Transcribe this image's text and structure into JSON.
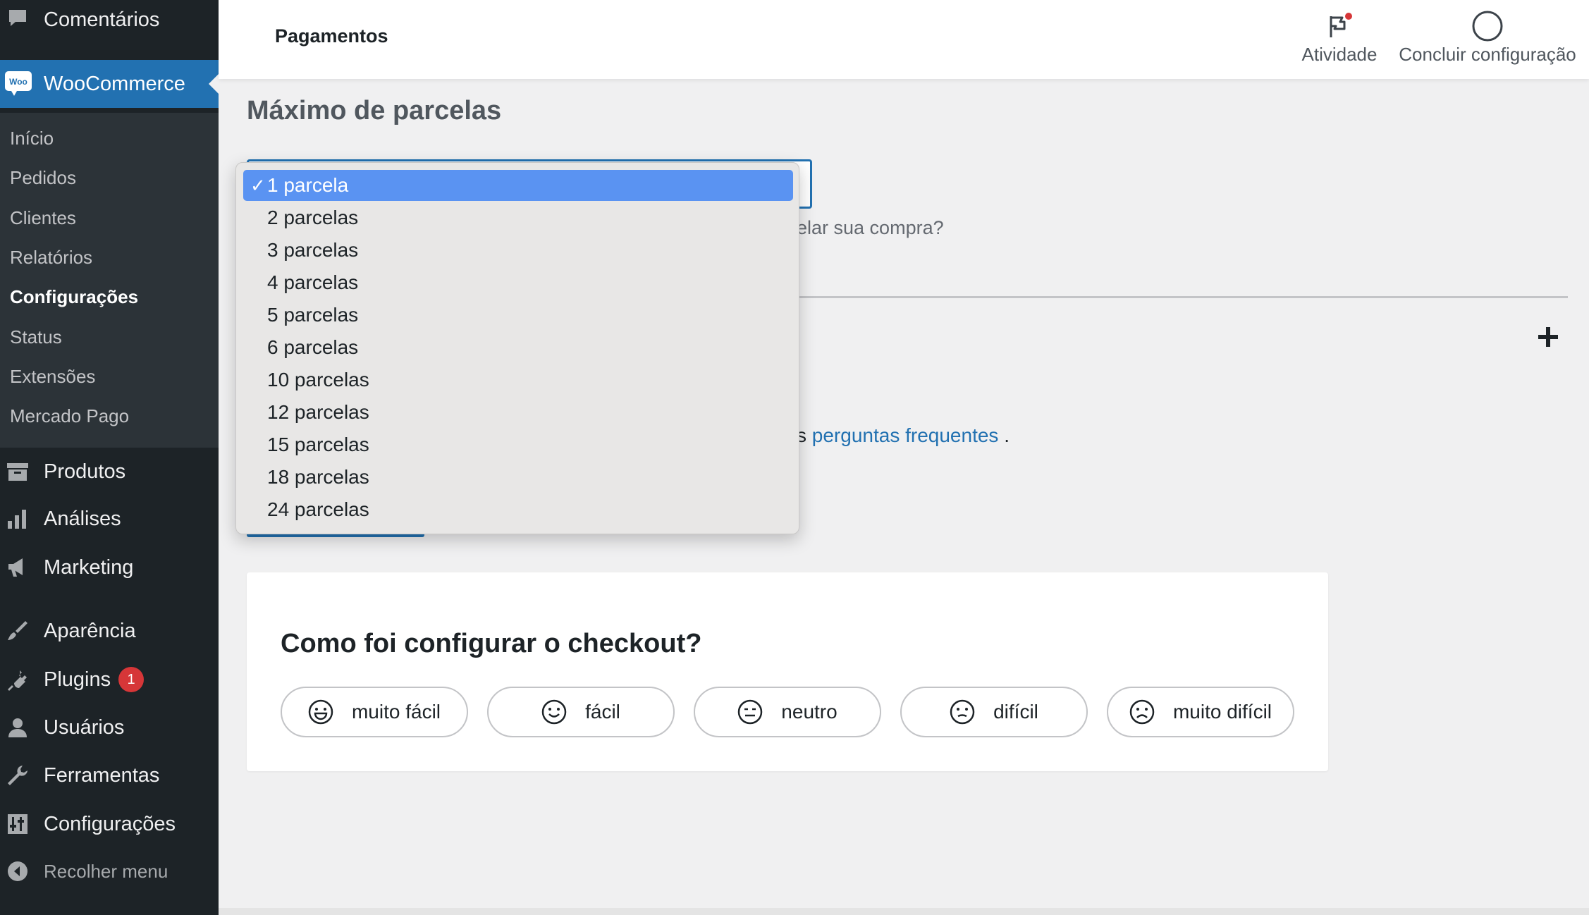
{
  "sidebar": {
    "items_top": [
      {
        "label": "Comentários",
        "icon": "comment-icon"
      }
    ],
    "woocommerce": {
      "label": "WooCommerce",
      "icon": "woo-logo-icon",
      "icon_text": "Woo"
    },
    "submenu": [
      {
        "label": "Início"
      },
      {
        "label": "Pedidos"
      },
      {
        "label": "Clientes"
      },
      {
        "label": "Relatórios"
      },
      {
        "label": "Configurações",
        "current": true
      },
      {
        "label": "Status"
      },
      {
        "label": "Extensões"
      },
      {
        "label": "Mercado Pago"
      }
    ],
    "items": [
      {
        "label": "Produtos",
        "icon": "archive-icon"
      },
      {
        "label": "Análises",
        "icon": "bar-chart-icon"
      },
      {
        "label": "Marketing",
        "icon": "megaphone-icon"
      },
      {
        "label": "Aparência",
        "icon": "brush-icon"
      },
      {
        "label": "Plugins",
        "icon": "plug-icon",
        "badge": "1"
      },
      {
        "label": "Usuários",
        "icon": "user-icon"
      },
      {
        "label": "Ferramentas",
        "icon": "wrench-icon"
      },
      {
        "label": "Configurações",
        "icon": "sliders-icon"
      }
    ],
    "collapse": {
      "label": "Recolher menu",
      "icon": "collapse-icon"
    }
  },
  "header": {
    "title": "Pagamentos",
    "activity": {
      "label": "Atividade",
      "icon": "flag-icon"
    },
    "setup": {
      "label": "Concluir configuração",
      "icon": "circle-progress-icon"
    }
  },
  "main": {
    "section_title": "Máximo de parcelas",
    "help_text_visible": "elar sua compra?",
    "faq_prefix": "s",
    "faq_link": "perguntas frequentes",
    "faq_suffix": "."
  },
  "dropdown": {
    "selected_check": "✓",
    "options": [
      "1 parcela",
      "2 parcelas",
      "3 parcelas",
      "4 parcelas",
      "5 parcelas",
      "6 parcelas",
      "10 parcelas",
      "12 parcelas",
      "15 parcelas",
      "18 parcelas",
      "24 parcelas"
    ],
    "selected_index": 0
  },
  "feedback": {
    "title": "Como foi configurar o checkout?",
    "options": [
      {
        "label": "muito fácil",
        "icon": "very-happy-face-icon"
      },
      {
        "label": "fácil",
        "icon": "happy-face-icon"
      },
      {
        "label": "neutro",
        "icon": "neutral-face-icon"
      },
      {
        "label": "difícil",
        "icon": "slightly-sad-face-icon"
      },
      {
        "label": "muito difícil",
        "icon": "sad-face-icon"
      }
    ]
  },
  "colors": {
    "sidebar_bg": "#1d2327",
    "submenu_bg": "#2c3338",
    "accent": "#2271b1",
    "badge": "#d63638",
    "dropdown_highlight": "#5a93f2",
    "notification_dot": "#d63638"
  }
}
